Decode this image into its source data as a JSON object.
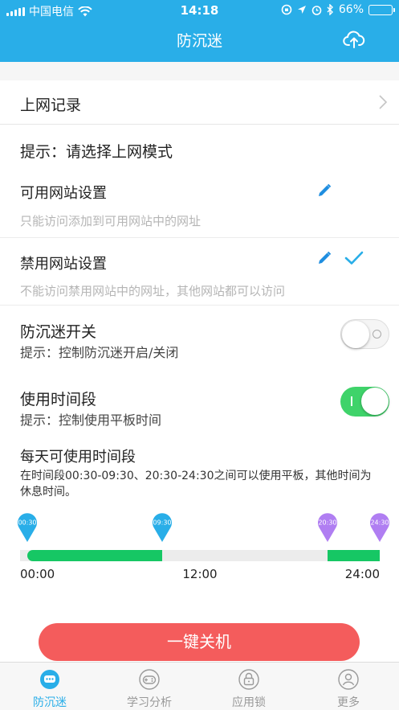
{
  "status_bar": {
    "carrier": "中国电信",
    "time": "14:18",
    "battery": "66%",
    "battery_level": 0.66
  },
  "nav": {
    "title": "防沉迷",
    "upload_icon": "cloud-upload-icon"
  },
  "record_row": {
    "label": "上网记录"
  },
  "mode_hint": "提示：请选择上网模式",
  "allowed_sites": {
    "title": "可用网站设置",
    "desc": "只能访问添加到可用网站中的网址"
  },
  "blocked_sites": {
    "title": "禁用网站设置",
    "desc": "不能访问禁用网站中的网址，其他网站都可以访问",
    "selected": true
  },
  "anti_addiction": {
    "title": "防沉迷开关",
    "desc": "提示：控制防沉迷开启/关闭",
    "enabled": false
  },
  "time_period": {
    "title": "使用时间段",
    "desc": "提示：控制使用平板时间",
    "enabled": true
  },
  "daily": {
    "title": "每天可使用时间段",
    "desc": "在时间段00:30-09:30、20:30-24:30之间可以使用平板，其他时间为休息时间。",
    "markers": [
      "00:30",
      "09:30",
      "20:30",
      "24:30"
    ],
    "ranges": [
      {
        "start": 0.5,
        "end": 9.5
      },
      {
        "start": 20.5,
        "end": 24.5
      }
    ],
    "axis_labels": [
      "00:00",
      "12:00",
      "24:00"
    ]
  },
  "colors": {
    "brand": "#29aee8",
    "green": "#16c764",
    "switch_on": "#3fd36a",
    "purple": "#b07ef2",
    "danger": "#f45c5c"
  },
  "shutdown_label": "一键关机",
  "tabs": [
    {
      "label": "防沉迷",
      "icon": "chat-bubble-icon",
      "active": true
    },
    {
      "label": "学习分析",
      "icon": "gamepad-icon",
      "active": false
    },
    {
      "label": "应用锁",
      "icon": "lock-icon",
      "active": false
    },
    {
      "label": "更多",
      "icon": "user-icon",
      "active": false
    }
  ]
}
